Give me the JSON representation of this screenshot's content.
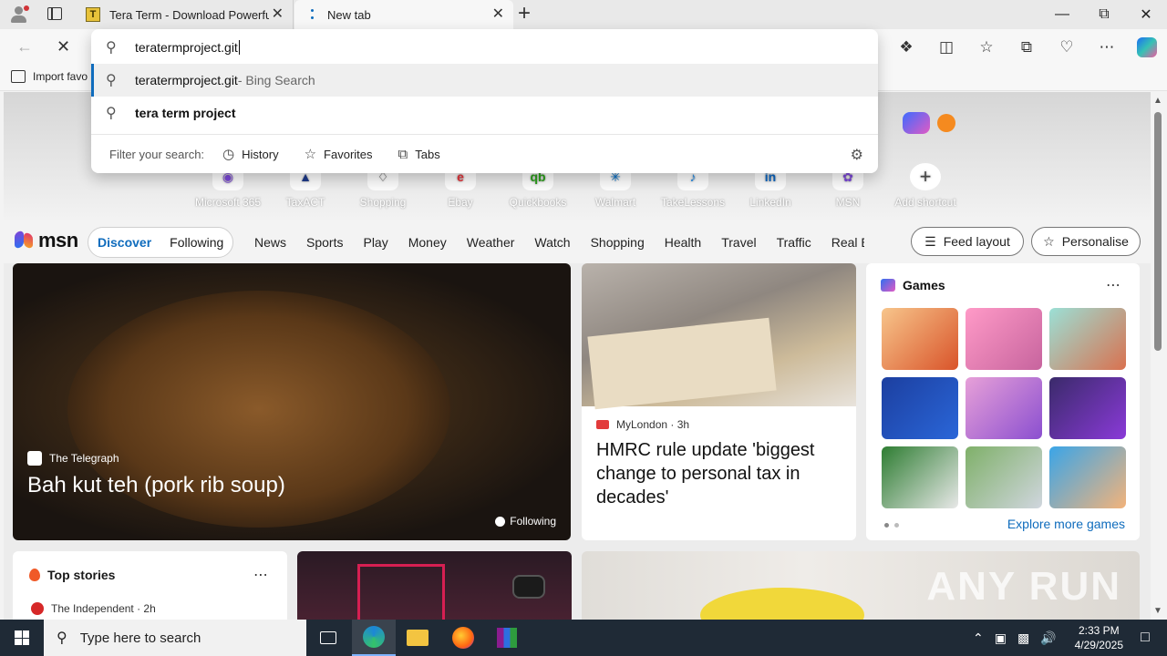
{
  "browser": {
    "tabs": [
      {
        "title": "Tera Term - Download Powerful T"
      },
      {
        "title": "New tab"
      }
    ],
    "address_value": "teratermproject.git",
    "favorites_bar": {
      "import_label": "Import favo"
    }
  },
  "omnibox": {
    "suggestions": [
      {
        "primary": "teratermproject.git",
        "secondary": " - Bing Search"
      },
      {
        "primary": "tera term project"
      }
    ],
    "filter_label": "Filter your search:",
    "filters": [
      "History",
      "Favorites",
      "Tabs"
    ]
  },
  "newtab": {
    "shortcuts": [
      "Microsoft 365",
      "TaxACT",
      "Shopping",
      "Ebay",
      "Quickbooks",
      "Walmart",
      "TakeLessons",
      "LinkedIn",
      "MSN",
      "Add shortcut"
    ],
    "msn": {
      "logo": "msn",
      "feed_tabs": [
        "Discover",
        "Following"
      ],
      "nav": [
        "News",
        "Sports",
        "Play",
        "Money",
        "Weather",
        "Watch",
        "Shopping",
        "Health",
        "Travel",
        "Traffic",
        "Real E"
      ],
      "feed_layout": "Feed layout",
      "personalise": "Personalise"
    },
    "hero_story": {
      "source": "The Telegraph",
      "headline": "Bah kut teh (pork rib soup)",
      "follow_label": "Following"
    },
    "second_story": {
      "source": "MyLondon · 3h",
      "headline": "HMRC rule update 'biggest change to personal tax in decades'"
    },
    "games": {
      "title": "Games",
      "explore": "Explore more games"
    },
    "top_stories": {
      "title": "Top stories",
      "source": "The Independent · 2h"
    },
    "watermark": "ANY RUN"
  },
  "taskbar": {
    "search_placeholder": "Type here to search",
    "time": "2:33 PM",
    "date": "4/29/2025"
  },
  "colors": {
    "accent": "#0f6cbd",
    "taskbar": "#1f2a36"
  }
}
